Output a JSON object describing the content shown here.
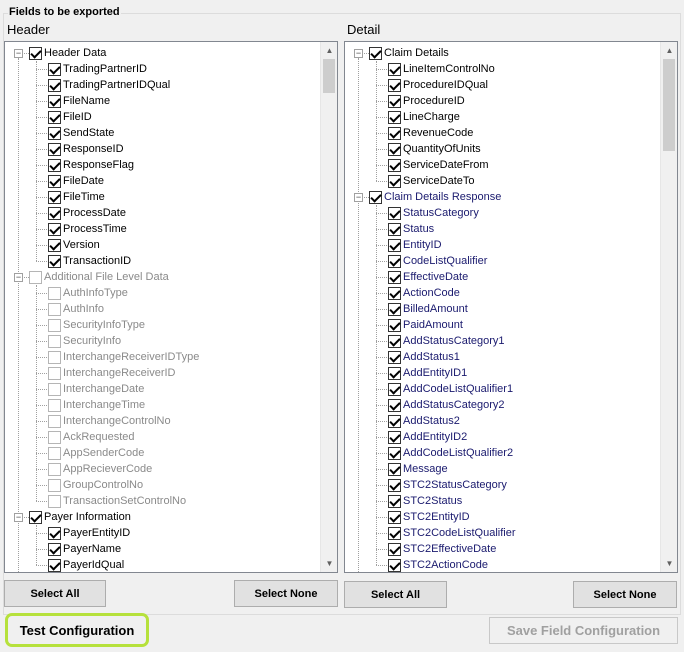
{
  "group_title": "Fields to be exported",
  "header": {
    "title": "Header",
    "nodes": [
      {
        "label": "Header Data",
        "checked": true,
        "disabled": false,
        "children": [
          {
            "label": "TradingPartnerID",
            "checked": true
          },
          {
            "label": "TradingPartnerIDQual",
            "checked": true
          },
          {
            "label": "FileName",
            "checked": true
          },
          {
            "label": "FileID",
            "checked": true
          },
          {
            "label": "SendState",
            "checked": true
          },
          {
            "label": "ResponseID",
            "checked": true
          },
          {
            "label": "ResponseFlag",
            "checked": true
          },
          {
            "label": "FileDate",
            "checked": true
          },
          {
            "label": "FileTime",
            "checked": true
          },
          {
            "label": "ProcessDate",
            "checked": true
          },
          {
            "label": "ProcessTime",
            "checked": true
          },
          {
            "label": "Version",
            "checked": true
          },
          {
            "label": "TransactionID",
            "checked": true
          }
        ]
      },
      {
        "label": "Additional File Level Data",
        "checked": false,
        "disabled": true,
        "children": [
          {
            "label": "AuthInfoType",
            "checked": false
          },
          {
            "label": "AuthInfo",
            "checked": false
          },
          {
            "label": "SecurityInfoType",
            "checked": false
          },
          {
            "label": "SecurityInfo",
            "checked": false
          },
          {
            "label": "InterchangeReceiverIDType",
            "checked": false
          },
          {
            "label": "InterchangeReceiverID",
            "checked": false
          },
          {
            "label": "InterchangeDate",
            "checked": false
          },
          {
            "label": "InterchangeTime",
            "checked": false
          },
          {
            "label": "InterchangeControlNo",
            "checked": false
          },
          {
            "label": "AckRequested",
            "checked": false
          },
          {
            "label": "AppSenderCode",
            "checked": false
          },
          {
            "label": "AppRecieverCode",
            "checked": false
          },
          {
            "label": "GroupControlNo",
            "checked": false
          },
          {
            "label": "TransactionSetControlNo",
            "checked": false
          }
        ]
      },
      {
        "label": "Payer Information",
        "checked": true,
        "disabled": false,
        "children": [
          {
            "label": "PayerEntityID",
            "checked": true
          },
          {
            "label": "PayerName",
            "checked": true
          },
          {
            "label": "PayerIdQual",
            "checked": true
          }
        ]
      }
    ],
    "select_all": "Select All",
    "select_none": "Select None"
  },
  "detail": {
    "title": "Detail",
    "nodes": [
      {
        "label": "Claim Details",
        "checked": true,
        "disabled": false,
        "blue": false,
        "children": [
          {
            "label": "LineItemControlNo",
            "checked": true
          },
          {
            "label": "ProcedureIDQual",
            "checked": true
          },
          {
            "label": "ProcedureID",
            "checked": true
          },
          {
            "label": "LineCharge",
            "checked": true
          },
          {
            "label": "RevenueCode",
            "checked": true
          },
          {
            "label": "QuantityOfUnits",
            "checked": true
          },
          {
            "label": "ServiceDateFrom",
            "checked": true
          },
          {
            "label": "ServiceDateTo",
            "checked": true
          }
        ]
      },
      {
        "label": "Claim Details Response",
        "checked": true,
        "disabled": false,
        "blue": true,
        "children": [
          {
            "label": "StatusCategory",
            "checked": true
          },
          {
            "label": "Status",
            "checked": true
          },
          {
            "label": "EntityID",
            "checked": true
          },
          {
            "label": "CodeListQualifier",
            "checked": true
          },
          {
            "label": "EffectiveDate",
            "checked": true
          },
          {
            "label": "ActionCode",
            "checked": true
          },
          {
            "label": "BilledAmount",
            "checked": true
          },
          {
            "label": "PaidAmount",
            "checked": true
          },
          {
            "label": "AddStatusCategory1",
            "checked": true
          },
          {
            "label": "AddStatus1",
            "checked": true
          },
          {
            "label": "AddEntityID1",
            "checked": true
          },
          {
            "label": "AddCodeListQualifier1",
            "checked": true
          },
          {
            "label": "AddStatusCategory2",
            "checked": true
          },
          {
            "label": "AddStatus2",
            "checked": true
          },
          {
            "label": "AddEntityID2",
            "checked": true
          },
          {
            "label": "AddCodeListQualifier2",
            "checked": true
          },
          {
            "label": "Message",
            "checked": true
          },
          {
            "label": "STC2StatusCategory",
            "checked": true
          },
          {
            "label": "STC2Status",
            "checked": true
          },
          {
            "label": "STC2EntityID",
            "checked": true
          },
          {
            "label": "STC2CodeListQualifier",
            "checked": true
          },
          {
            "label": "STC2EffectiveDate",
            "checked": true
          },
          {
            "label": "STC2ActionCode",
            "checked": true
          }
        ]
      }
    ],
    "select_all": "Select All",
    "select_none": "Select None"
  },
  "footer": {
    "test_configuration": "Test Configuration",
    "save_field_configuration": "Save Field Configuration"
  },
  "icons": {
    "expander_expanded": "minus-box",
    "scroll_up": "chevron-up",
    "scroll_down": "chevron-down"
  },
  "colors": {
    "highlight_ring": "#b6e13c",
    "blue_text": "#1a1a6e"
  }
}
